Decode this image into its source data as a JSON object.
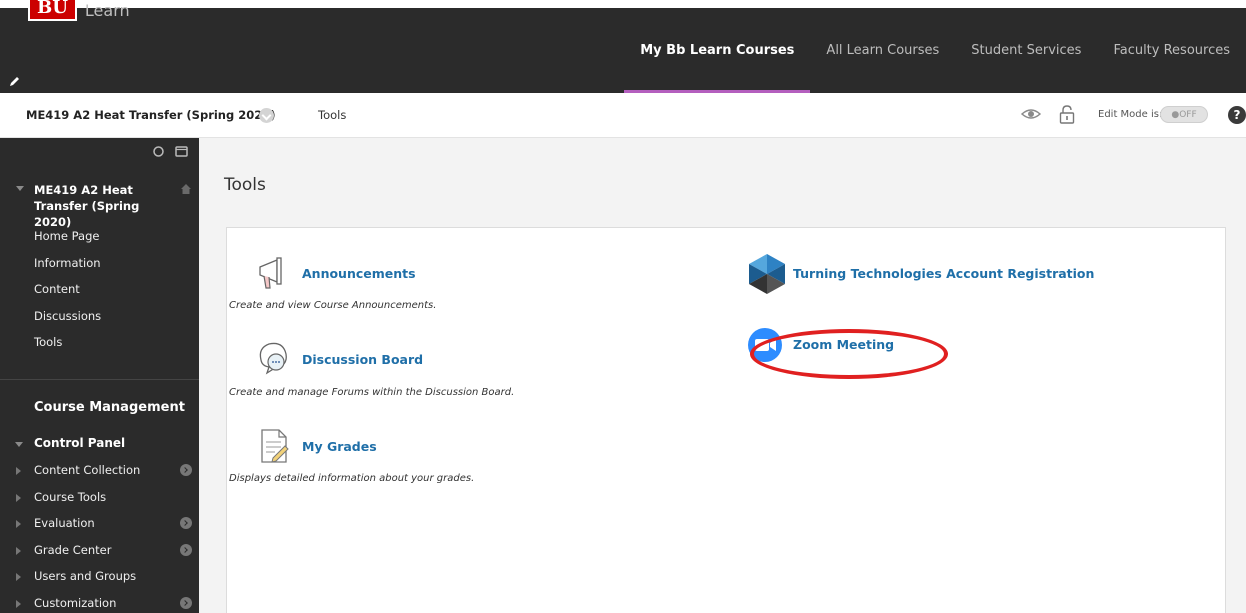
{
  "brand": {
    "logo_text": "BU",
    "product": "Learn"
  },
  "topnav": {
    "items": [
      {
        "label": "My Bb Learn Courses",
        "active": true
      },
      {
        "label": "All Learn Courses",
        "active": false
      },
      {
        "label": "Student Services",
        "active": false
      },
      {
        "label": "Faculty Resources",
        "active": false
      }
    ]
  },
  "breadcrumb": {
    "course": "ME419 A2 Heat Transfer (Spring 2020)",
    "page": "Tools",
    "edit_mode_label": "Edit Mode is:",
    "edit_mode_value": "OFF",
    "help": "?"
  },
  "sidebar": {
    "course_title": "ME419 A2 Heat Transfer (Spring 2020)",
    "links": [
      "Home Page",
      "Information",
      "Content",
      "Discussions",
      "Tools"
    ],
    "management_title": "Course Management",
    "control_panel": "Control Panel",
    "cp_items": [
      {
        "label": "Content Collection",
        "has_arrow": true
      },
      {
        "label": "Course Tools",
        "has_arrow": false
      },
      {
        "label": "Evaluation",
        "has_arrow": true
      },
      {
        "label": "Grade Center",
        "has_arrow": true
      },
      {
        "label": "Users and Groups",
        "has_arrow": false
      },
      {
        "label": "Customization",
        "has_arrow": true
      }
    ]
  },
  "main": {
    "title": "Tools",
    "tools": [
      {
        "name": "Announcements",
        "desc": "Create and view Course Announcements.",
        "icon": "megaphone-icon"
      },
      {
        "name": "Discussion Board",
        "desc": "Create and manage Forums within the Discussion Board.",
        "icon": "speech-bubble-icon"
      },
      {
        "name": "My Grades",
        "desc": "Displays detailed information about your grades.",
        "icon": "grades-document-icon"
      },
      {
        "name": "Turning Technologies Account Registration",
        "desc": "",
        "icon": "turning-technologies-icon"
      },
      {
        "name": "Zoom Meeting",
        "desc": "",
        "icon": "zoom-camera-icon"
      }
    ]
  },
  "colors": {
    "topbar": "#2b2b2b",
    "accent": "#b45fbe",
    "link": "#1f6fa8",
    "highlight": "#e02020",
    "logo": "#cc0000"
  }
}
